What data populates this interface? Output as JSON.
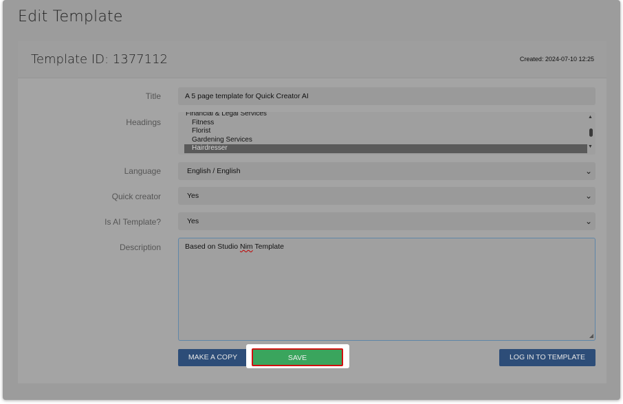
{
  "page": {
    "title": "Edit Template"
  },
  "card": {
    "template_id_label": "Template ID: 1377112",
    "created": "Created: 2024-07-10 12:25"
  },
  "form": {
    "title": {
      "label": "Title",
      "value": "A 5 page template for Quick Creator AI"
    },
    "headings": {
      "label": "Headings",
      "options": [
        "Financial & Legal Services",
        "Fitness",
        "Florist",
        "Gardening Services",
        "Hairdresser"
      ],
      "selected": "Hairdresser"
    },
    "language": {
      "label": "Language",
      "value": "English / English"
    },
    "quick_creator": {
      "label": "Quick creator",
      "value": "Yes"
    },
    "is_ai_template": {
      "label": "Is AI Template?",
      "value": "Yes"
    },
    "description": {
      "label": "Description",
      "value_before": "Based on Studio ",
      "value_misspelled": "Nim",
      "value_after": " Template"
    }
  },
  "buttons": {
    "make_copy": "MAKE A COPY",
    "save": "SAVE",
    "log_in": "LOG IN TO TEMPLATE"
  },
  "colors": {
    "primary_button": "#2d4d78",
    "save_button": "#3aa55d",
    "highlight_border": "#d10f0f"
  },
  "icons": {
    "select_chevron": "chevron-down-icon",
    "scroll_up": "scroll-up-arrow-icon",
    "scroll_down": "scroll-down-arrow-icon",
    "resize": "resize-grip-icon"
  }
}
